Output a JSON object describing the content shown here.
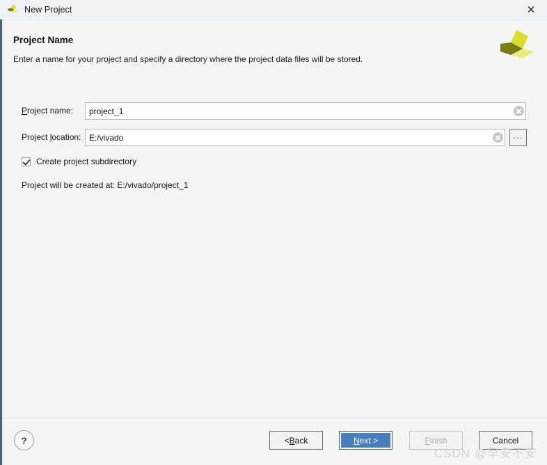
{
  "window": {
    "title": "New Project",
    "icon": "vivado-logo-icon",
    "close_label": "✕"
  },
  "header": {
    "title": "Project Name",
    "subtitle": "Enter a name for your project and specify a directory where the project data files will be stored.",
    "logo": "xilinx-logo-icon"
  },
  "form": {
    "project_name": {
      "label_prefix": "",
      "label_mnemonic": "P",
      "label_suffix": "roject name:",
      "value": "project_1",
      "placeholder": "",
      "clear_icon": "clear-circle-icon"
    },
    "project_location": {
      "label_prefix": "Project ",
      "label_mnemonic": "l",
      "label_suffix": "ocation:",
      "value": "E:/vivado",
      "placeholder": "",
      "clear_icon": "clear-circle-icon",
      "browse_label": "..."
    },
    "create_subdirectory": {
      "label": "Create project subdirectory",
      "checked": true
    },
    "status_text": "Project will be created at: E:/vivado/project_1"
  },
  "footer": {
    "help_label": "?",
    "buttons": [
      {
        "prefix": "< ",
        "mnemonic": "B",
        "suffix": "ack",
        "state": "normal"
      },
      {
        "prefix": "",
        "mnemonic": "N",
        "suffix": "ext >",
        "state": "default"
      },
      {
        "prefix": "",
        "mnemonic": "F",
        "suffix": "inish",
        "state": "disabled"
      },
      {
        "prefix": "",
        "mnemonic": "",
        "suffix": "Cancel",
        "state": "normal"
      }
    ]
  },
  "watermark": "CSDN @早安不安",
  "colors": {
    "accent_blue": "#4a7ebb",
    "left_strip": "#4f6275",
    "body_bg": "#f5f5f5",
    "titlebar_bg": "#eef2f5",
    "logo_dark": "#7a7a18",
    "logo_bright": "#d7e02e",
    "logo_light": "#e6ef7e"
  }
}
